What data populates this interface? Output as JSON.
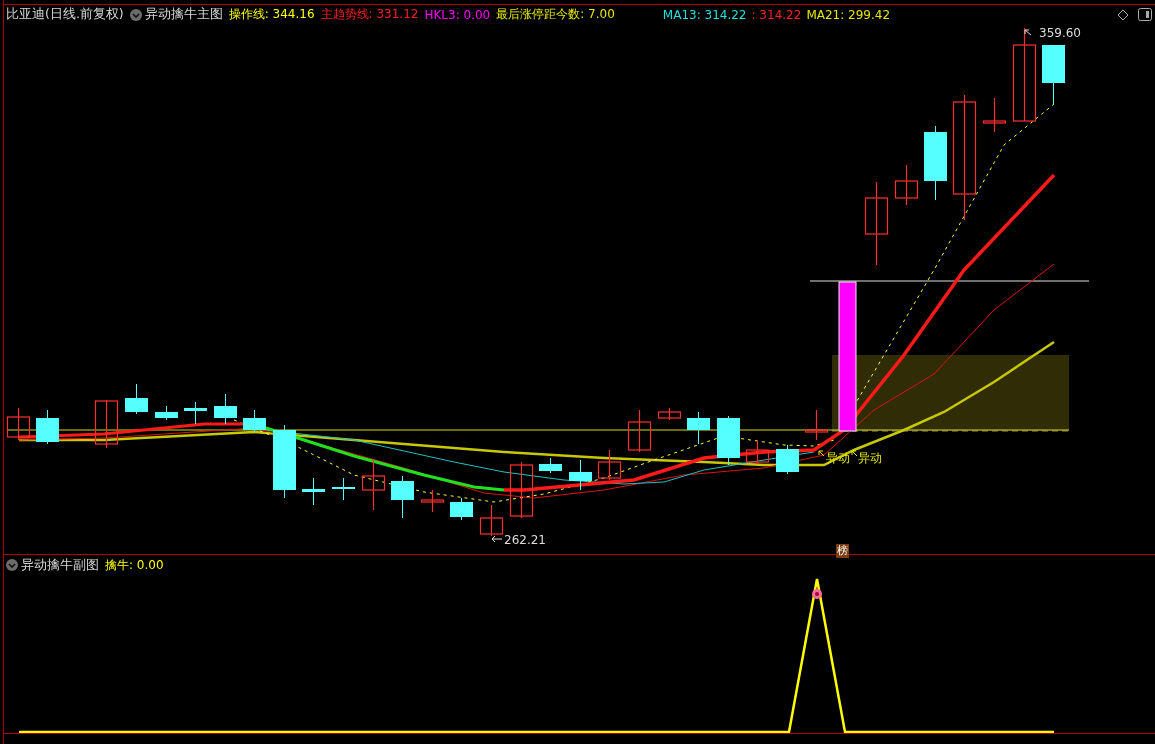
{
  "header": {
    "stock": "比亚迪(日线.前复权)",
    "indicator": "异动擒牛主图",
    "values": [
      {
        "text": "操作线: 344.16",
        "color": "#ffff00"
      },
      {
        "text": "主趋势线: 331.12",
        "color": "#ff2020"
      },
      {
        "text": "HKL3: 0.00",
        "color": "#ff00ff"
      },
      {
        "text": "最后涨停距今数: 7.00",
        "color": "#e6e600"
      }
    ],
    "ma_values": [
      {
        "text": "MA13: 314.22",
        "color": "#22e0e0"
      },
      {
        "text": ": 314.22",
        "color": "#ff2020"
      },
      {
        "text": "MA21: 299.42",
        "color": "#e6e600"
      }
    ]
  },
  "main_chart": {
    "high_label": "359.60",
    "low_label": "262.21",
    "signals": [
      "异动",
      "异动"
    ],
    "badge": "榜"
  },
  "sub_chart": {
    "indicator": "异动擒牛副图",
    "value": "擒牛: 0.00"
  }
}
